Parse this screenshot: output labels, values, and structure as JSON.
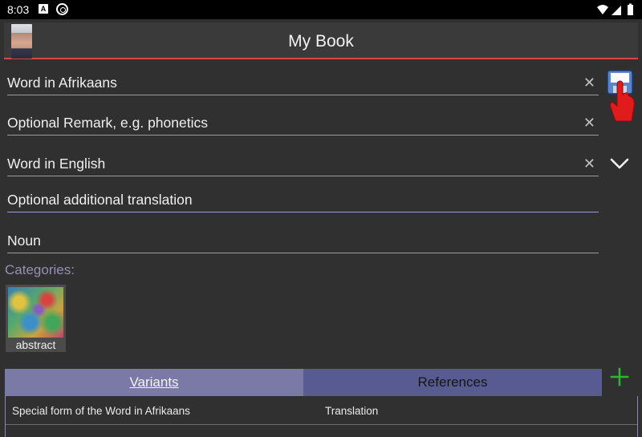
{
  "status_bar": {
    "time": "8:03",
    "a_badge": "A"
  },
  "app_bar": {
    "title": "My Book"
  },
  "form": {
    "word": "Word in Afrikaans",
    "remark": "Optional Remark, e.g. phonetics",
    "translation": "Word in English",
    "additional_translation": "Optional additional translation",
    "word_type": "Noun",
    "clear_symbol": "✕"
  },
  "categories": {
    "label": "Categories:",
    "items": [
      {
        "name": "abstract"
      }
    ]
  },
  "tabs": {
    "variants": "Variants",
    "references": "References"
  },
  "table": {
    "columns": [
      "Special form of the Word in Afrikaans",
      "Translation"
    ]
  },
  "colors": {
    "accent_red": "#d94545",
    "tab_active": "#7b7aa6",
    "tab_inactive": "#585b92",
    "add_green": "#2fb52f"
  }
}
